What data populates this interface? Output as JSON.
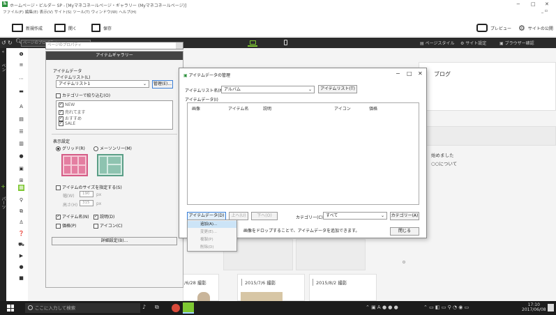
{
  "window": {
    "title": "ホームページ・ビルダー SP - [Myマネコネールページ・ギャラリー (Myマネコネールページ)]",
    "app_icon": "hb-app-icon"
  },
  "menu": {
    "items": "ファイル(F)  編集(E)  表示(V)  サイト(S)  ツール(T)  ウィンドウ(W)  ヘルプ(H)"
  },
  "toolbar": {
    "new": "新規作成",
    "open": "開く",
    "save": "保存",
    "preview": "プレビュー",
    "site_publish": "サイトの公開"
  },
  "darkbar": {
    "page_props_placeholder": "ページのプロパティ",
    "page_style": "ページスタイル",
    "site_settings": "サイト設定",
    "browser_check": "ブラウザー確認"
  },
  "left_strip": {
    "top_label": "ペン",
    "bottom_label": "パーツ"
  },
  "gallery": {
    "header": "アイテムギャラリー",
    "item_data_label": "アイテムデータ",
    "item_list_label": "アイテムリスト(L)",
    "item_list_value": "アイテムリスト1",
    "manage_button": "管理(E)...",
    "category_filter": "カテゴリーで絞り込む(O)",
    "categories": [
      "NEW",
      "売れてます",
      "おすすめ",
      "SALE"
    ],
    "display_label": "表示設定",
    "grid_option": "グリッド(R)",
    "masonry_option": "メーソンリー(M)",
    "size_option": "アイテムのサイズを指定する(S)",
    "width_label": "幅(W)",
    "width_value": "190",
    "height_label": "高さ(H)",
    "height_value": "315",
    "unit": "px",
    "show_name": "アイテム名(N)",
    "show_desc": "説明(D)",
    "show_price": "価格(P)",
    "show_icon": "アイコン(C)",
    "detail_button": "詳細設定(B)..."
  },
  "dialog": {
    "title": "アイテムデータの管理",
    "list_name_label": "アイテムリスト名(N)：",
    "list_name_value": "アルバム",
    "item_list_button": "アイテムリスト(T)",
    "data_label": "アイテムデータ(I)",
    "columns": [
      "画像",
      "アイテム名",
      "説明",
      "アイコン",
      "価格"
    ],
    "item_data_button": "アイテムデータ(D)",
    "up_button": "上へ(U)",
    "down_button": "下へ(O)",
    "category_label": "カテゴリー(C)：",
    "category_value": "すべて",
    "category_button": "カテゴリー(A)",
    "hint": "画像をドロップすることで、アイテムデータを追加できます。",
    "close_button": "閉じる"
  },
  "context_menu": [
    "追加(A)...",
    "変更(E)...",
    "複製(P)",
    "削除(D)"
  ],
  "canvas": {
    "blog_heading": "ブログ",
    "news_line1": "始めました",
    "news_line2": "○○について",
    "captions": [
      "/6/28 撮影",
      "2015/7/6 撮影",
      "2015/8/2 撮影"
    ]
  },
  "taskbar": {
    "search_placeholder": "ここに入力して検索",
    "time": "17:10",
    "date": "2017/06/08"
  },
  "colors": {
    "accent_green": "#7ec832",
    "dark_bar": "#2b2b2b",
    "menu_highlight": "#cce4f7"
  }
}
